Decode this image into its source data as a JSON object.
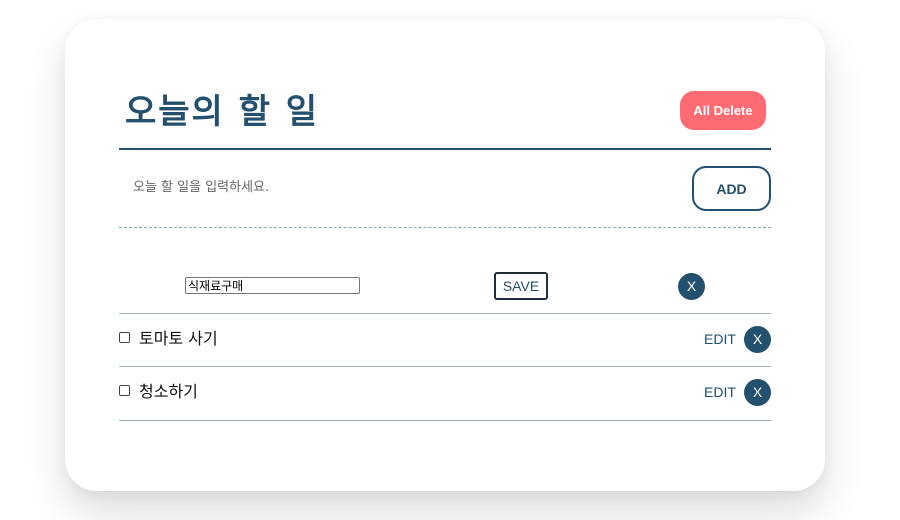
{
  "header": {
    "title": "오늘의 할 일",
    "all_delete_label": "All Delete"
  },
  "input": {
    "placeholder": "오늘 할 일을 입력하세요.",
    "value": "",
    "add_label": "ADD"
  },
  "editing_item": {
    "value": "식재료구매",
    "save_label": "SAVE",
    "delete_label": "X"
  },
  "todos": [
    {
      "text": "토마토 사기",
      "checked": false,
      "edit_label": "EDIT",
      "delete_label": "X"
    },
    {
      "text": "청소하기",
      "checked": false,
      "edit_label": "EDIT",
      "delete_label": "X"
    }
  ],
  "colors": {
    "primary": "#23506e",
    "danger": "#ff6b72",
    "divider": "#9fb3bf"
  }
}
